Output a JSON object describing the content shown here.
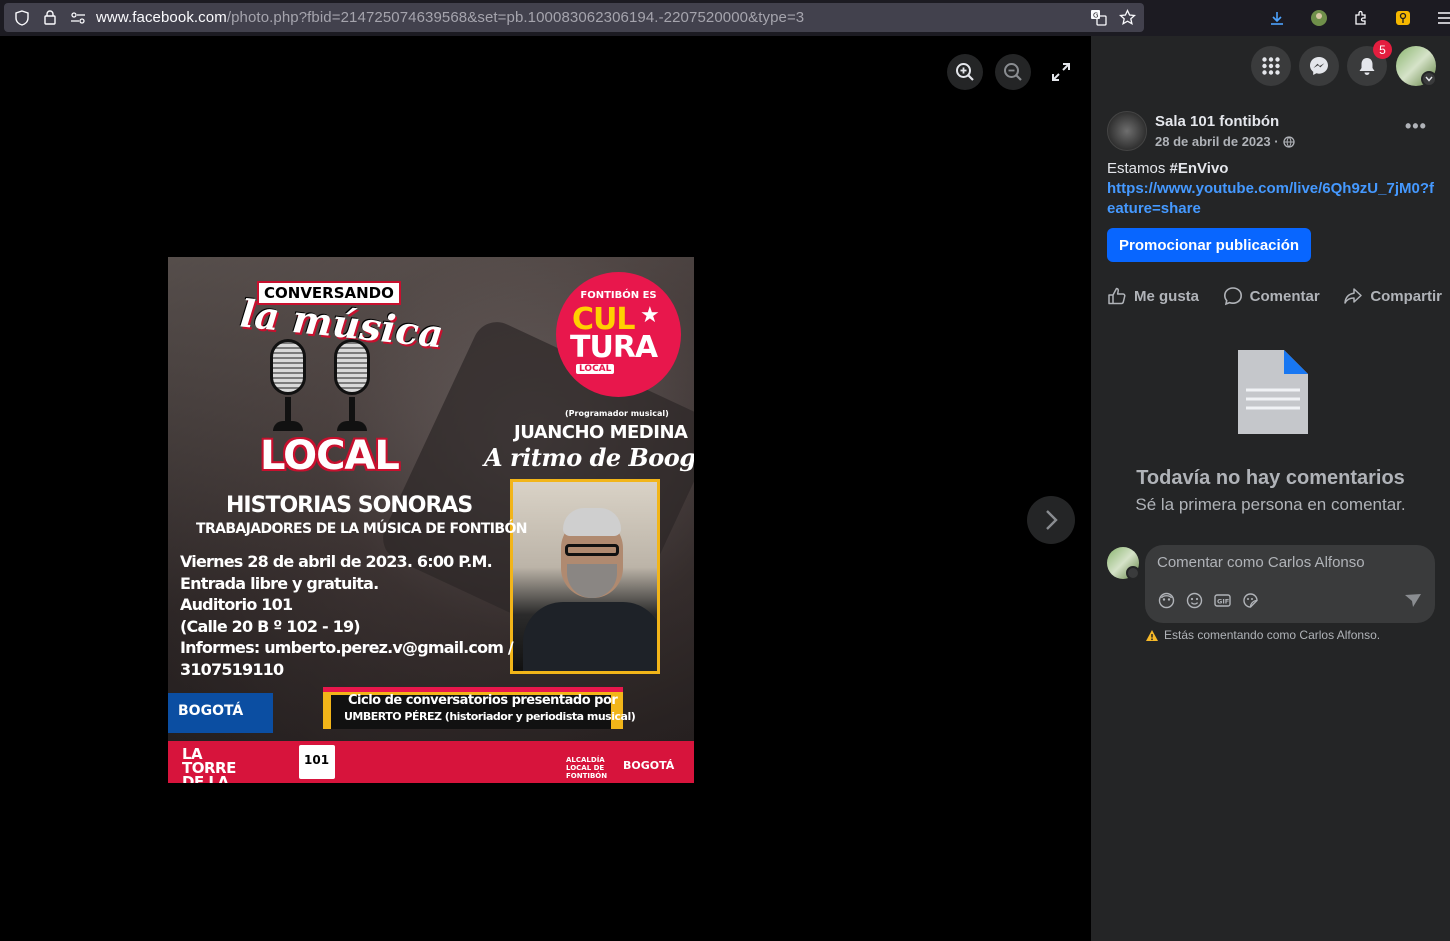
{
  "browser": {
    "url_host": "www.facebook.com",
    "url_path": "/photo.php?fbid=214725074639568&set=pb.100083062306194.-2207520000&type=3"
  },
  "viewer": {
    "icons": [
      "zoom-in-icon",
      "zoom-out-icon",
      "fullscreen-icon",
      "chevron-right-icon"
    ]
  },
  "poster": {
    "conversando": "CONVERSANDO",
    "la_musica": "la música",
    "local": "LOCAL",
    "cultura_top": "FONTIBÓN ES",
    "cultura_cul": "CUL",
    "cultura_tura": "TURA",
    "cultura_local": "LOCAL",
    "programador": "(Programador musical)",
    "guest_name": "JUANCHO MEDINA",
    "tagline": "A ritmo de Boogaloop",
    "historias": "HISTORIAS SONORAS",
    "trabajadores": "TRABAJADORES DE LA MÚSICA DE FONTIBÓN",
    "info": "Viernes 28 de abril de 2023. 6:00 P.M.\nEntrada libre y gratuita.\nAuditorio 101\n(Calle 20 B º 102 - 19)\nInformes: umberto.perez.v@gmail.com /\n3107519110",
    "bogota_chip": "BOGOTÁ",
    "ciclo_line1": "Ciclo de conversatorios presentado por",
    "ciclo_line2": "UMBERTO PÉREZ (historiador y periodista musical)",
    "torre": "LA TORRE DE LA CANCIÓN",
    "auditorio": "101",
    "alcaldia": "ALCALDÍA LOCAL DE FONTIBÓN",
    "bogota_foot": "BOGOTÁ"
  },
  "header": {
    "notifications_count": "5"
  },
  "post": {
    "page_name": "Sala 101 fontibón",
    "date": "28 de abril de 2023 ·",
    "text_prefix": "Estamos ",
    "hashtag": "#EnVivo",
    "link": "https://www.youtube.com/live/6Qh9zU_7jM0?feature=share",
    "promote_label": "Promocionar publicación",
    "like_label": "Me gusta",
    "comment_label": "Comentar",
    "share_label": "Compartir"
  },
  "comments": {
    "empty_title": "Todavía no hay comentarios",
    "empty_subtitle": "Sé la primera persona en comentar.",
    "placeholder": "Comentar como Carlos Alfonso",
    "warning": "Estás comentando como Carlos Alfonso."
  },
  "colors": {
    "accent": "#0866ff",
    "link": "#4599ff",
    "badge": "#e41e3f"
  }
}
